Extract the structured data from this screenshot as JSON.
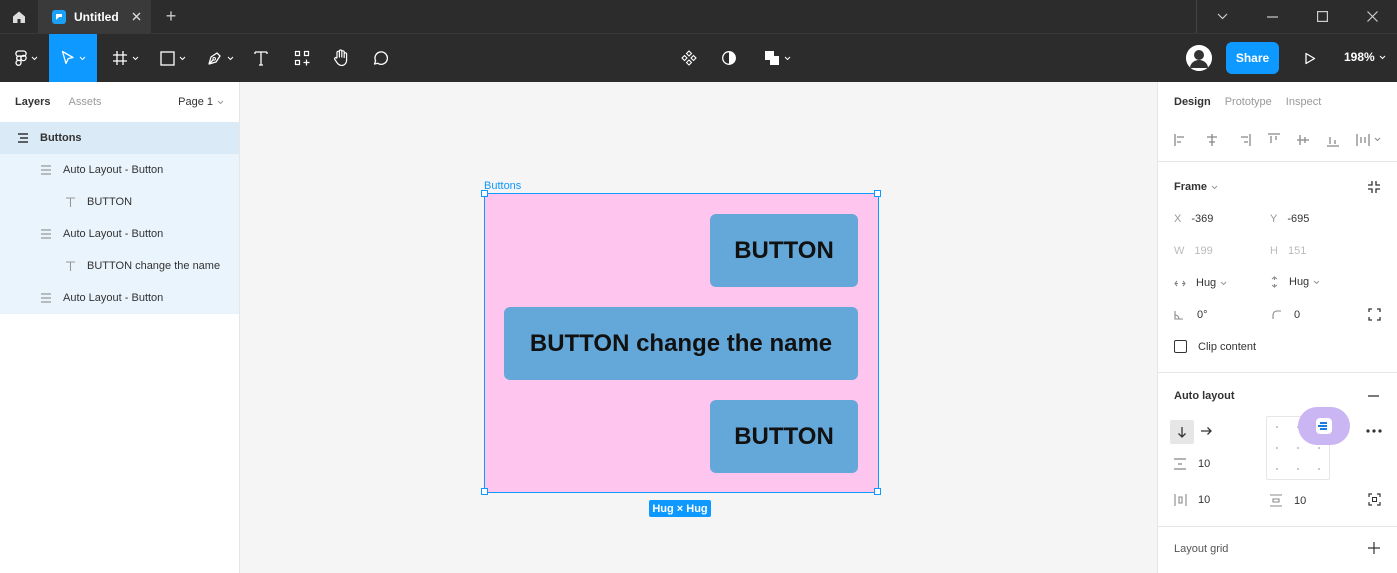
{
  "titlebar": {
    "tab_title": "Untitled",
    "new_tab": "+"
  },
  "toolbar": {
    "share_label": "Share",
    "zoom": "198%"
  },
  "left_panel": {
    "tabs": [
      "Layers",
      "Assets"
    ],
    "page_label": "Page 1",
    "layers": [
      {
        "label": "Buttons"
      },
      {
        "label": "Auto Layout - Button"
      },
      {
        "label": "BUTTON"
      },
      {
        "label": "Auto Layout - Button"
      },
      {
        "label": "BUTTON change the name"
      },
      {
        "label": "Auto Layout - Button"
      }
    ]
  },
  "canvas": {
    "frame_label": "Buttons",
    "buttons": [
      "BUTTON",
      "BUTTON change the name",
      "BUTTON"
    ],
    "size_badge": "Hug × Hug"
  },
  "right_panel": {
    "tabs": [
      "Design",
      "Prototype",
      "Inspect"
    ],
    "frame_title": "Frame",
    "x_label": "X",
    "x_value": "-369",
    "y_label": "Y",
    "y_value": "-695",
    "w_label": "W",
    "w_value": "199",
    "h_label": "H",
    "h_value": "151",
    "hug_w": "Hug",
    "hug_h": "Hug",
    "rotation": "0°",
    "radius": "0",
    "clip_content": "Clip content",
    "auto_layout_title": "Auto layout",
    "spacing": "10",
    "padding_h": "10",
    "padding_v": "10",
    "layout_grid_title": "Layout grid"
  },
  "colors": {
    "accent": "#0d99ff",
    "frame_fill": "#fec5ee",
    "button_fill": "#63a8d9"
  }
}
